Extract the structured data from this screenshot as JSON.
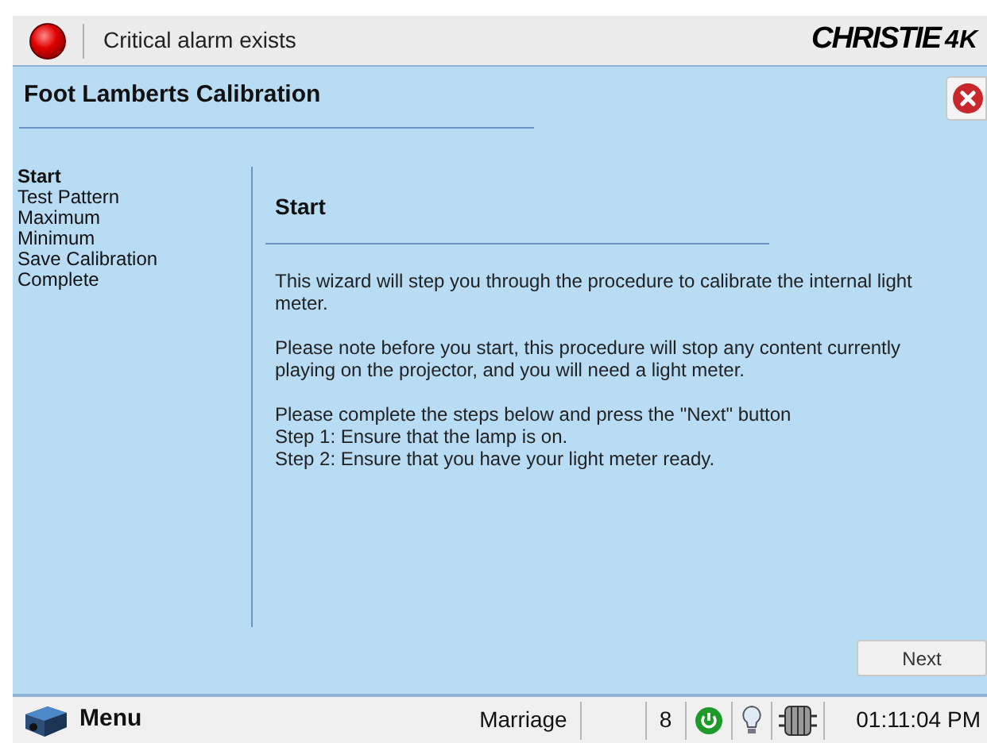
{
  "header": {
    "alarm": "Critical alarm exists",
    "logo": "CHRISTIE",
    "logo_suffix": "4K"
  },
  "wizard": {
    "title": "Foot Lamberts Calibration",
    "steps": [
      {
        "label": "Start",
        "selected": true
      },
      {
        "label": "Test Pattern",
        "selected": false
      },
      {
        "label": "Maximum",
        "selected": false
      },
      {
        "label": "Minimum",
        "selected": false
      },
      {
        "label": "Save Calibration",
        "selected": false
      },
      {
        "label": "Complete",
        "selected": false
      }
    ],
    "page_title": "Start",
    "paragraphs": [
      [
        "This wizard will step you through the procedure to calibrate the internal light meter."
      ],
      [
        "Please note before you start, this procedure will stop any content currently playing on the projector, and you will need a light meter."
      ],
      [
        "Please complete the steps below and press the \"Next\" button",
        "Step 1: Ensure that the lamp is on.",
        "Step 2: Ensure that you have your light meter ready."
      ]
    ],
    "next_button": "Next"
  },
  "status_bar": {
    "menu": "Menu",
    "device": "Marriage",
    "count": "8",
    "time": "01:11:04 PM"
  }
}
